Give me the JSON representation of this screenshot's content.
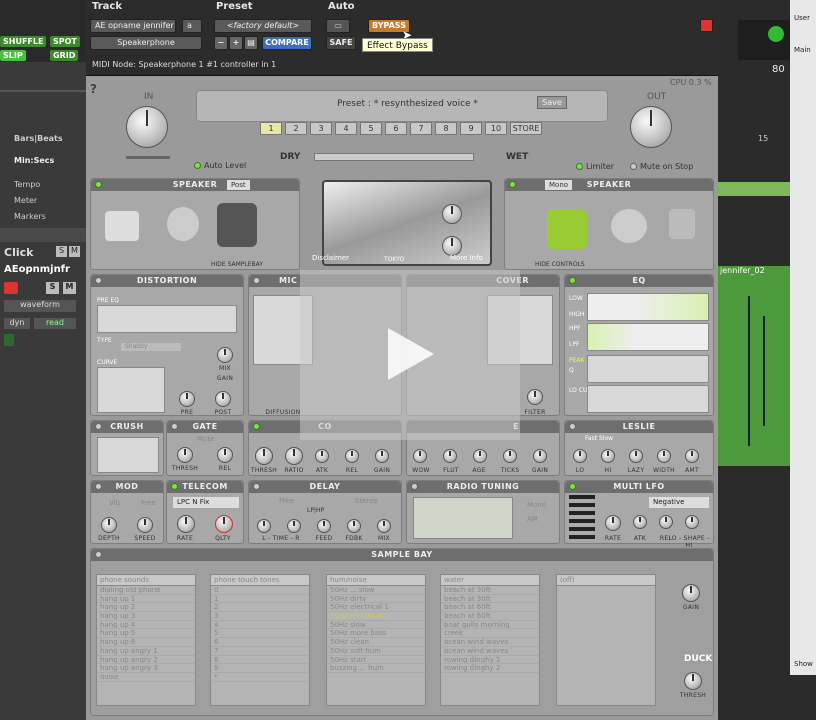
{
  "daw_left": {
    "shuffle": "SHUFFLE",
    "spot": "SPOT",
    "slip": "SLIP",
    "grid": "GRID",
    "rulers": [
      "Bars|Beats",
      "Min:Secs",
      "Tempo",
      "Meter",
      "Markers"
    ],
    "click": "Click",
    "s": "S",
    "m": "M",
    "track_name": "AEopnmjnfr",
    "waveform": "waveform",
    "dyn": "dyn",
    "read": "read"
  },
  "daw_right": {
    "counter": "80",
    "marker": "15",
    "clip": "jennifer_02",
    "user": "User",
    "main": "Main",
    "show": "Show"
  },
  "header": {
    "track_label": "Track",
    "preset_label": "Preset",
    "auto_label": "Auto",
    "track_name": "AE opname jennifer",
    "track_slot": "a",
    "insert_name": "Speakerphone",
    "preset_value": "<factory default>",
    "compare": "COMPARE",
    "bypass": "BYPASS",
    "safe": "SAFE",
    "tooltip": "Effect Bypass",
    "midi_node": "MIDI Node: Speakerphone 1 #1 controller in 1"
  },
  "plugin": {
    "cpu": "CPU 0.3 %",
    "in": "IN",
    "out": "OUT",
    "help": "?",
    "preset_text": "Preset :  * resynthesized voice *",
    "save": "Save",
    "slots": [
      "1",
      "2",
      "3",
      "4",
      "5",
      "6",
      "7",
      "8",
      "9",
      "10"
    ],
    "store": "STORE",
    "dry": "DRY",
    "wet": "WET",
    "auto_level": "Auto Level",
    "limiter": "Limiter",
    "mute_on_stop": "Mute on Stop",
    "speaker_left": "SPEAKER",
    "post": "Post",
    "speaker_right": "SPEAKER",
    "mono": "Mono",
    "hide_samplebay": "HIDE SAMPLEBAY",
    "hide_controls": "HIDE CONTROLS",
    "disclaimer": "Disclaimer",
    "more_info": "More Info",
    "radio_brand": "TOKYO",
    "distortion": "DISTORTION",
    "mic": "MIC",
    "cover": "COVER",
    "eq": "EQ",
    "dist_labels": [
      "PRE EQ",
      "TYPE",
      "CURVE"
    ],
    "dist_type": "Shabby",
    "dist_knobs": [
      "GAIN",
      "MIX",
      "PRE",
      "POST"
    ],
    "mic_knobs": [
      "DIFFUSION"
    ],
    "cover_knobs": [
      "FILTER"
    ],
    "eq_labels": [
      "LOW",
      "HIGH",
      "HPF",
      "LPF",
      "PEAK",
      "Q",
      "LO CUT"
    ],
    "crush": "CRUSH",
    "gate": "GATE",
    "comp": "CO",
    "e_label": "E",
    "leslie": "LESLIE",
    "crush_knobs": [],
    "gate_mode": "Mute",
    "gate_knobs": [
      "THRESH",
      "REL"
    ],
    "comp_knobs": [
      "THRESH",
      "RATIO",
      "ATK",
      "REL",
      "GAIN"
    ],
    "e_knobs": [
      "WOW",
      "FLUT",
      "AGE",
      "TICKS",
      "GAIN"
    ],
    "leslie_mode": "Fast  Slow",
    "leslie_knobs": [
      "LO",
      "HI",
      "LAZY",
      "WIDTH",
      "AMT"
    ],
    "mod": "MOD",
    "telecom": "TELECOM",
    "delay": "DELAY",
    "radio_tuning": "RADIO TUNING",
    "multi_lfo": "MULTI LFO",
    "mod_mode": "Vib",
    "mod_free": "Free",
    "mod_knobs": [
      "DEPTH",
      "SPEED"
    ],
    "telecom_mode": "LPC N Fix",
    "telecom_knobs": [
      "RATE",
      "QLTY"
    ],
    "delay_free": "Free",
    "delay_stereo": "Stereo",
    "delay_mode": "LP|HP",
    "delay_knobs": [
      "L - TIME - R",
      "FEED",
      "FDBK",
      "MIX"
    ],
    "tuning_mono": "Mono",
    "tuning_am": "AM",
    "negative": "Negative",
    "lfo_knobs": [
      "RATE",
      "ATK",
      "REL",
      "LO - SHAPE - HI"
    ],
    "sample_bay": "SAMPLE BAY",
    "pre": "Pre",
    "duck": "DUCK",
    "gain": "GAIN",
    "thresh": "THRESH",
    "bay_columns": [
      {
        "head": "phone sounds",
        "items": [
          "dialing old phone",
          "hang up 1",
          "hang up 2",
          "hang up 3",
          "hang up 4",
          "hang up 5",
          "hang up 6",
          "hang up angry 1",
          "hang up angry 2",
          "hang up angry 3",
          "noise"
        ]
      },
      {
        "head": "phone touch tones",
        "items": [
          "0",
          "1",
          "2",
          "3",
          "4",
          "5",
          "6",
          "7",
          "8",
          "9",
          "*"
        ]
      },
      {
        "head": "hum/noise",
        "items": [
          "50Hz ... slow",
          "50Hz dirty",
          "50Hz electrical 1",
          "50Hz electrical 2",
          "50Hz slow",
          "50Hz more bass",
          "50Hz clean",
          "50Hz soft hum",
          "50Hz start",
          "buzzing ... hum"
        ]
      },
      {
        "head": "water",
        "items": [
          "beach at 30ft",
          "beach at 30ft",
          "beach at 60ft",
          "beach at 60ft",
          "boat gulls morning",
          "creek",
          "ocean wind waves",
          "ocean wind waves",
          "rowing dinghy 1",
          "rowing dinghy 2"
        ]
      },
      {
        "head": "(off)",
        "items": []
      }
    ]
  },
  "colors": {
    "accent_green": "#7fe04a",
    "bypass_orange": "#c87a2a",
    "compare_blue": "#3c6fc0",
    "bg_plugin": "#9a9a9a"
  }
}
